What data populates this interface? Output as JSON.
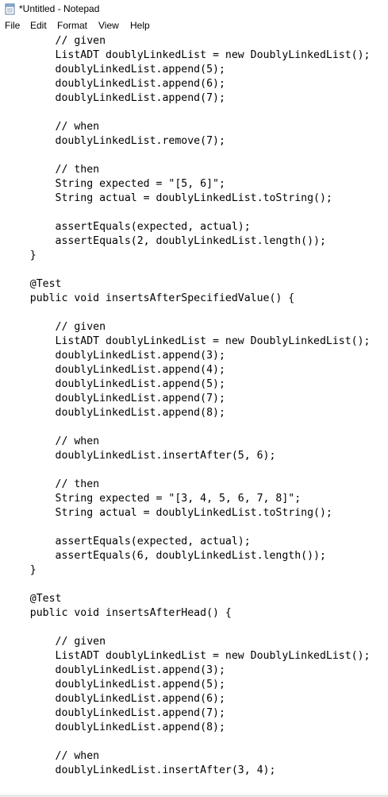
{
  "window": {
    "title": "*Untitled - Notepad",
    "icon": "notepad-icon"
  },
  "menu": {
    "items": [
      "File",
      "Edit",
      "Format",
      "View",
      "Help"
    ]
  },
  "editor": {
    "lines": [
      "        // given",
      "        ListADT doublyLinkedList = new DoublyLinkedList();",
      "        doublyLinkedList.append(5);",
      "        doublyLinkedList.append(6);",
      "        doublyLinkedList.append(7);",
      "",
      "        // when",
      "        doublyLinkedList.remove(7);",
      "",
      "        // then",
      "        String expected = \"[5, 6]\";",
      "        String actual = doublyLinkedList.toString();",
      "",
      "        assertEquals(expected, actual);",
      "        assertEquals(2, doublyLinkedList.length());",
      "    }",
      "",
      "    @Test",
      "    public void insertsAfterSpecifiedValue() {",
      "",
      "        // given",
      "        ListADT doublyLinkedList = new DoublyLinkedList();",
      "        doublyLinkedList.append(3);",
      "        doublyLinkedList.append(4);",
      "        doublyLinkedList.append(5);",
      "        doublyLinkedList.append(7);",
      "        doublyLinkedList.append(8);",
      "",
      "        // when",
      "        doublyLinkedList.insertAfter(5, 6);",
      "",
      "        // then",
      "        String expected = \"[3, 4, 5, 6, 7, 8]\";",
      "        String actual = doublyLinkedList.toString();",
      "",
      "        assertEquals(expected, actual);",
      "        assertEquals(6, doublyLinkedList.length());",
      "    }",
      "",
      "    @Test",
      "    public void insertsAfterHead() {",
      "",
      "        // given",
      "        ListADT doublyLinkedList = new DoublyLinkedList();",
      "        doublyLinkedList.append(3);",
      "        doublyLinkedList.append(5);",
      "        doublyLinkedList.append(6);",
      "        doublyLinkedList.append(7);",
      "        doublyLinkedList.append(8);",
      "",
      "        // when",
      "        doublyLinkedList.insertAfter(3, 4);"
    ]
  }
}
